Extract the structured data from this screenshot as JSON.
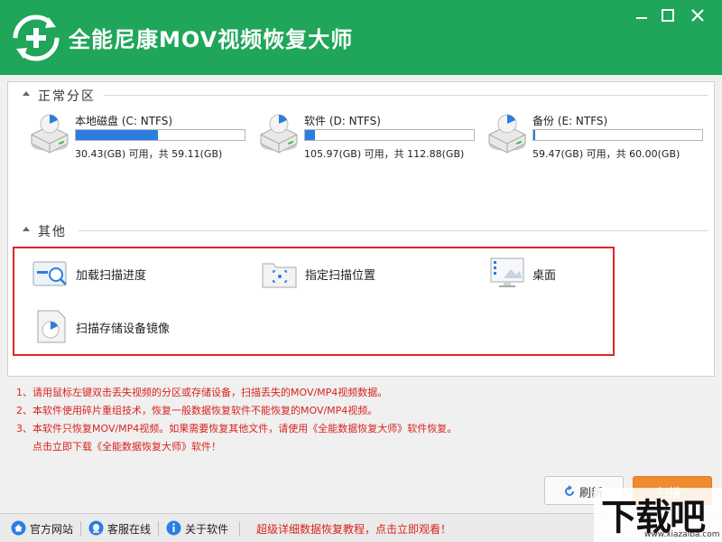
{
  "window": {
    "title": "全能尼康MOV视频恢复大师",
    "minimize_icon": "minimize-icon",
    "maximize_icon": "maximize-icon",
    "close_icon": "close-icon"
  },
  "colors": {
    "titlebar": "#1fa65a",
    "accent_orange": "#f08a2e",
    "note_red": "#d9231d",
    "bar_blue": "#2b7de1",
    "highlight_border": "#e0242a"
  },
  "sections": {
    "normal": "正常分区",
    "other": "其他"
  },
  "drives": [
    {
      "name": "本地磁盘 (C: NTFS)",
      "info": "30.43(GB) 可用，共 59.11(GB)",
      "used_fraction": 0.485
    },
    {
      "name": "软件 (D: NTFS)",
      "info": "105.97(GB) 可用，共 112.88(GB)",
      "used_fraction": 0.061
    },
    {
      "name": "备份 (E: NTFS)",
      "info": "59.47(GB) 可用，共 60.00(GB)",
      "used_fraction": 0.009
    }
  ],
  "options": [
    {
      "label": "加载扫描进度",
      "icon": "load-progress-icon"
    },
    {
      "label": "指定扫描位置",
      "icon": "folder-scan-icon"
    },
    {
      "label": "桌面",
      "icon": "desktop-icon"
    },
    {
      "label": "扫描存储设备镜像",
      "icon": "disk-image-icon"
    }
  ],
  "notes": [
    "1、请用鼠标左键双击丢失视频的分区或存储设备，扫描丢失的MOV/MP4视频数据。",
    "2、本软件使用碎片重组技术，恢复一般数据恢复软件不能恢复的MOV/MP4视频。",
    "3、本软件只恢复MOV/MP4视频。如果需要恢复其他文件，请使用《全能数据恢复大师》软件恢复。",
    "点击立即下载《全能数据恢复大师》软件！"
  ],
  "buttons": {
    "refresh": "刷新",
    "scan": "扫描"
  },
  "statusbar": {
    "website": "官方网站",
    "service": "客服在线",
    "about": "关于软件",
    "promo": "超级详细数据恢复教程，点击立即观看！"
  },
  "watermark": {
    "big": "下载吧",
    "small": "www.xiazaiba.com"
  }
}
